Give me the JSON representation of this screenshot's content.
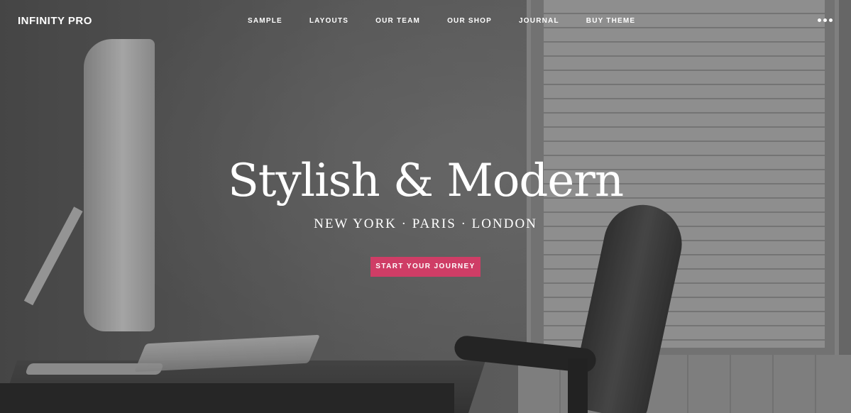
{
  "header": {
    "site_title": "INFINITY PRO",
    "nav": [
      {
        "label": "SAMPLE"
      },
      {
        "label": "LAYOUTS"
      },
      {
        "label": "OUR TEAM"
      },
      {
        "label": "OUR SHOP"
      },
      {
        "label": "JOURNAL"
      },
      {
        "label": "BUY THEME"
      }
    ],
    "menu_icon": "more-dots-icon"
  },
  "hero": {
    "title": "Stylish & Modern",
    "subtitle": "NEW YORK · PARIS · LONDON",
    "cta_label": "START YOUR JOURNEY",
    "cta_color": "#cf3d66"
  }
}
